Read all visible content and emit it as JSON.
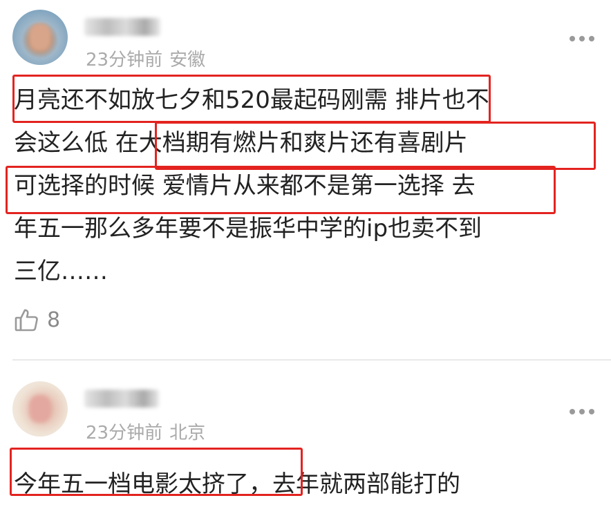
{
  "comments": [
    {
      "time": "23分钟前",
      "location": "安徽",
      "lines": [
        "月亮还不如放七夕和520最起码刚需 排片也不",
        "会这么低  在大档期有燃片和爽片还有喜剧片",
        "可选择的时候 爱情片从来都不是第一选择  去",
        "年五一那么多年要不是振华中学的ip也卖不到",
        "三亿……"
      ],
      "likes": "8"
    },
    {
      "time": "23分钟前",
      "location": "北京",
      "lines": [
        "今年五一档电影太挤了，去年就两部能打的"
      ]
    }
  ],
  "colors": {
    "highlight": "#e3231f",
    "meta": "#aaaaaa",
    "text": "#222222"
  },
  "icons": [
    "avatar",
    "more-icon",
    "thumbs-up-icon"
  ]
}
